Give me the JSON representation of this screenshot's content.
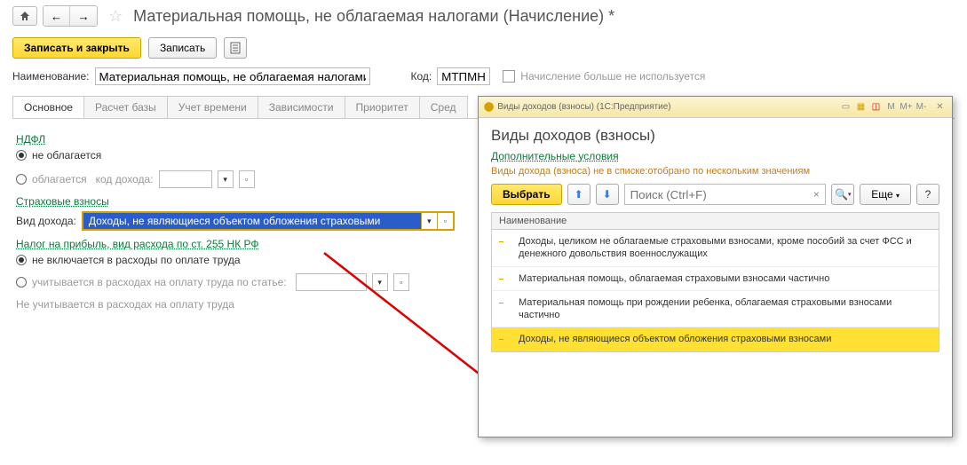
{
  "header": {
    "title": "Материальная помощь, не облагаемая налогами (Начисление) *"
  },
  "actions": {
    "save_close": "Записать и закрыть",
    "save": "Записать"
  },
  "form": {
    "name_label": "Наименование:",
    "name_value": "Материальная помощь, не облагаемая налогами",
    "code_label": "Код:",
    "code_value": "МТПМН",
    "unused": "Начисление больше не используется"
  },
  "tabs": [
    "Основное",
    "Расчет базы",
    "Учет времени",
    "Зависимости",
    "Приоритет",
    "Сред"
  ],
  "ndfl": {
    "title": "НДФЛ",
    "opt1": "не облагается",
    "opt2": "облагается",
    "code_label": "код дохода:"
  },
  "insurance": {
    "title": "Страховые взносы",
    "type_label": "Вид дохода:",
    "type_value": "Доходы, не являющиеся объектом обложения страховыми"
  },
  "profit": {
    "title": "Налог на прибыль, вид расхода по ст. 255 НК РФ",
    "opt1": "не включается в расходы по оплате труда",
    "opt2": "учитывается в расходах на оплату труда по статье:"
  },
  "footer_note": "Не учитывается в расходах на оплату труда",
  "popup": {
    "win_title": "Виды доходов (взносы) (1С:Предприятие)",
    "title": "Виды доходов (взносы)",
    "extra_cond": "Дополнительные условия",
    "filter_text": "Виды дохода (взноса) не в списке:отобрано по нескольким значениям",
    "select_btn": "Выбрать",
    "search_ph": "Поиск (Ctrl+F)",
    "more_btn": "Еще",
    "col_header": "Наименование",
    "items": [
      "Доходы, целиком не облагаемые страховыми взносами, кроме пособий за счет ФСС и денежного довольствия военнослужащих",
      "Материальная помощь, облагаемая страховыми взносами частично",
      "Материальная помощь при рождении ребенка, облагаемая страховыми взносами частично",
      "Доходы, не являющиеся объектом обложения страховыми взносами"
    ]
  }
}
